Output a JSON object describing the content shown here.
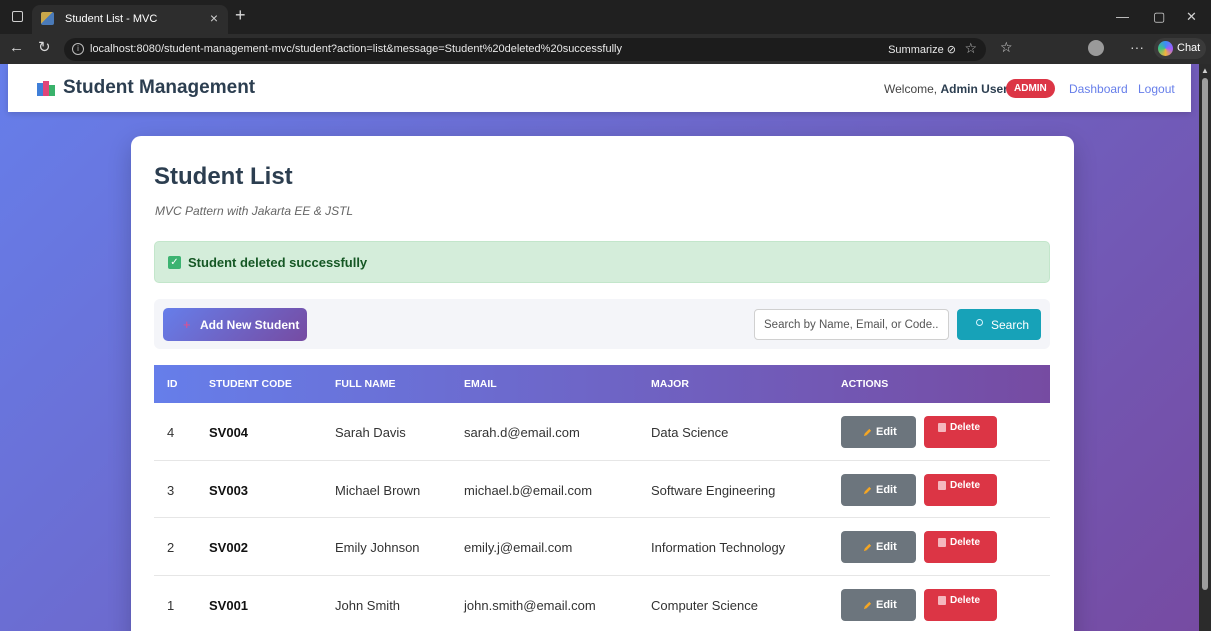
{
  "browser": {
    "tab_title": "Student List - MVC",
    "tab_close": "×",
    "new_tab": "+",
    "url": "localhost:8080/student-management-mvc/student?action=list&message=Student%20deleted%20successfully",
    "summarize_label": "Summarize",
    "chat_label": "Chat",
    "more_label": "···",
    "window_controls": {
      "minimize": "—",
      "restore": "▢",
      "close": "✕"
    }
  },
  "nav": {
    "brand": "Student Management",
    "welcome_prefix": "Welcome,",
    "user_name": "Admin User",
    "role_badge": "ADMIN",
    "dashboard_link": "Dashboard",
    "logout_link": "Logout"
  },
  "page": {
    "title": "Student List",
    "subtitle": "MVC Pattern with Jakarta EE & JSTL"
  },
  "alert": {
    "message": "Student deleted successfully",
    "color": "#d4edda"
  },
  "actions": {
    "add_label": "Add New Student",
    "search_placeholder": "Search by Name, Email, or Code...",
    "search_label": "Search"
  },
  "table": {
    "headers": [
      "ID",
      "STUDENT CODE",
      "FULL NAME",
      "EMAIL",
      "MAJOR",
      "ACTIONS"
    ],
    "edit_label": "Edit",
    "delete_label": "Delete",
    "rows": [
      {
        "id": "4",
        "code": "SV004",
        "name": "Sarah Davis",
        "email": "sarah.d@email.com",
        "major": "Data Science"
      },
      {
        "id": "3",
        "code": "SV003",
        "name": "Michael Brown",
        "email": "michael.b@email.com",
        "major": "Software Engineering"
      },
      {
        "id": "2",
        "code": "SV002",
        "name": "Emily Johnson",
        "email": "emily.j@email.com",
        "major": "Information Technology"
      },
      {
        "id": "1",
        "code": "SV001",
        "name": "John Smith",
        "email": "john.smith@email.com",
        "major": "Computer Science"
      }
    ]
  },
  "colors": {
    "accent_start": "#667eea",
    "accent_end": "#764ba2",
    "danger": "#dc3545",
    "search": "#17a2b8",
    "edit": "#6c757d"
  }
}
